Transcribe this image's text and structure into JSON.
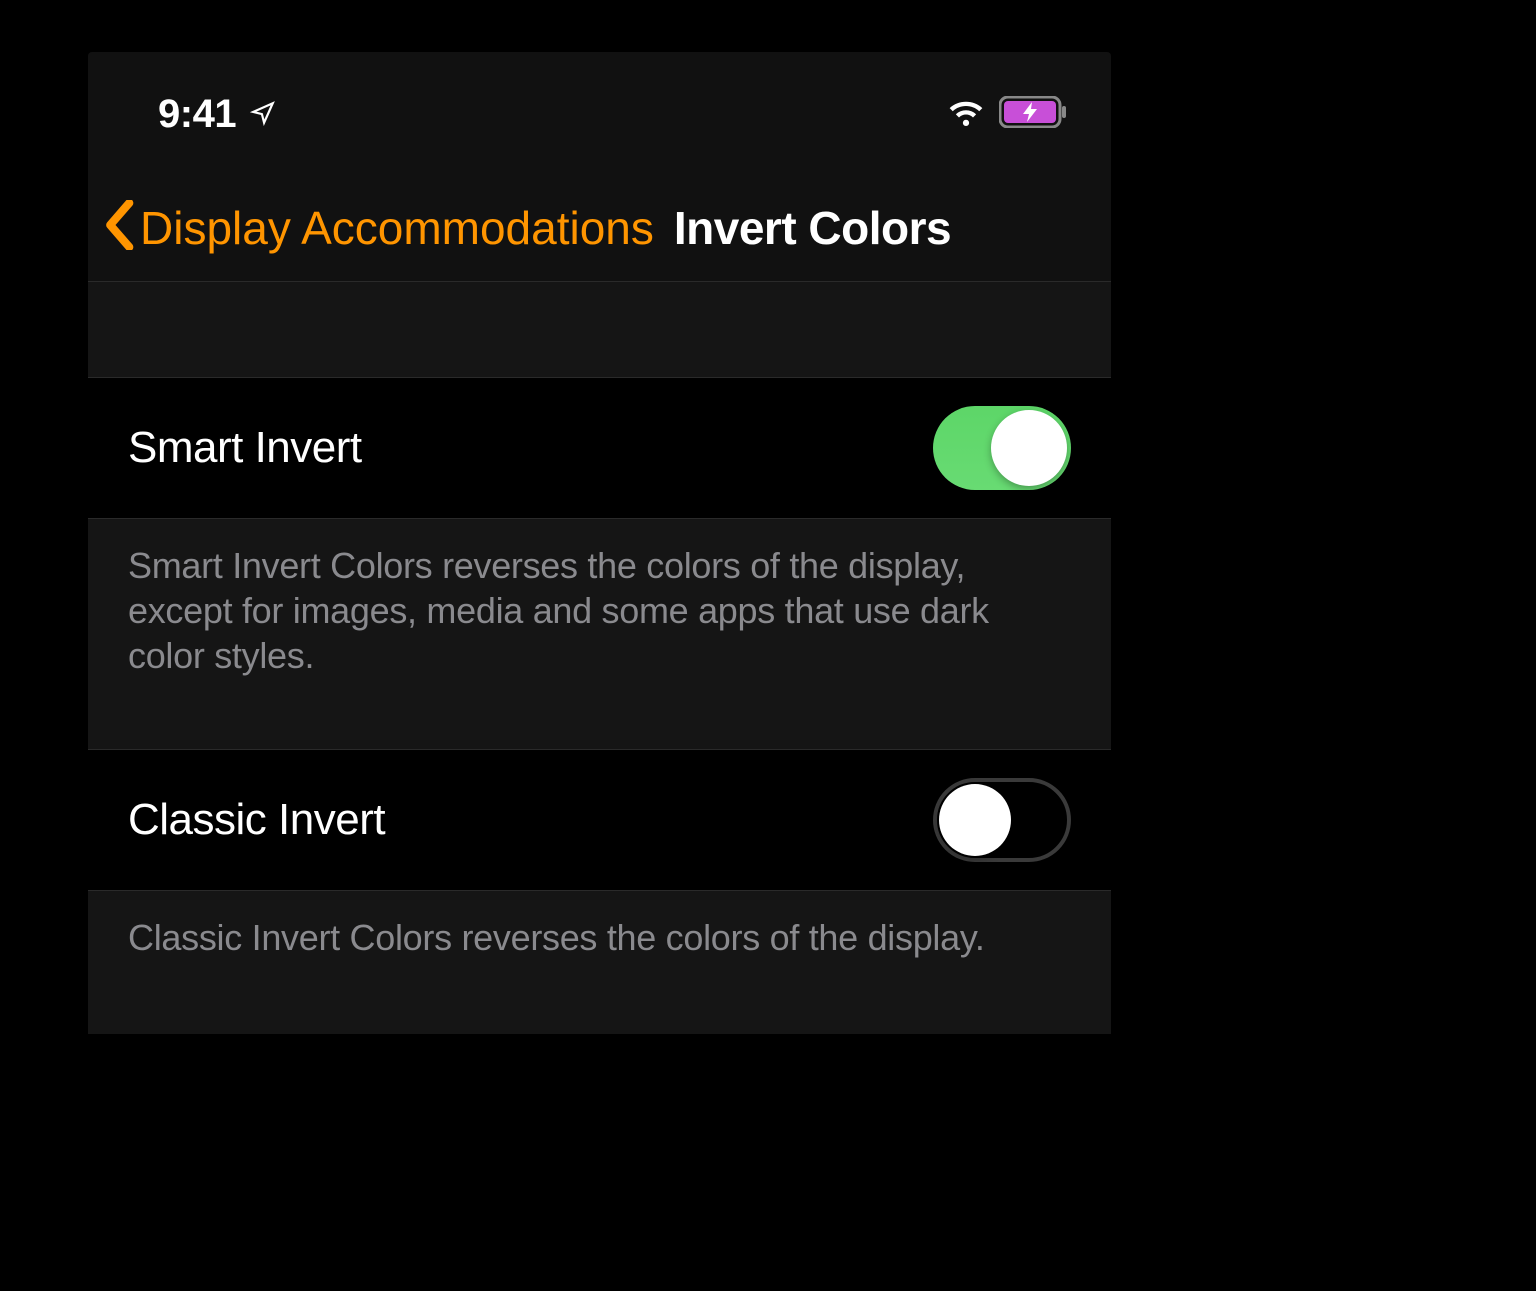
{
  "status_bar": {
    "time": "9:41",
    "location_icon": "location-arrow",
    "wifi_icon": "wifi",
    "battery_icon": "battery-charging",
    "battery_color": "#c84fd8"
  },
  "nav": {
    "back_label": "Display Accommodations",
    "title": "Invert Colors",
    "accent_color": "#ff9500"
  },
  "settings": [
    {
      "label": "Smart Invert",
      "enabled": true,
      "description": "Smart Invert Colors reverses the colors of the display, except for images, media and some apps that use dark color styles."
    },
    {
      "label": "Classic Invert",
      "enabled": false,
      "description": "Classic Invert Colors reverses the colors of the display."
    }
  ],
  "toggle_colors": {
    "on": "#65d96f",
    "off_border": "#3a3a3a"
  }
}
